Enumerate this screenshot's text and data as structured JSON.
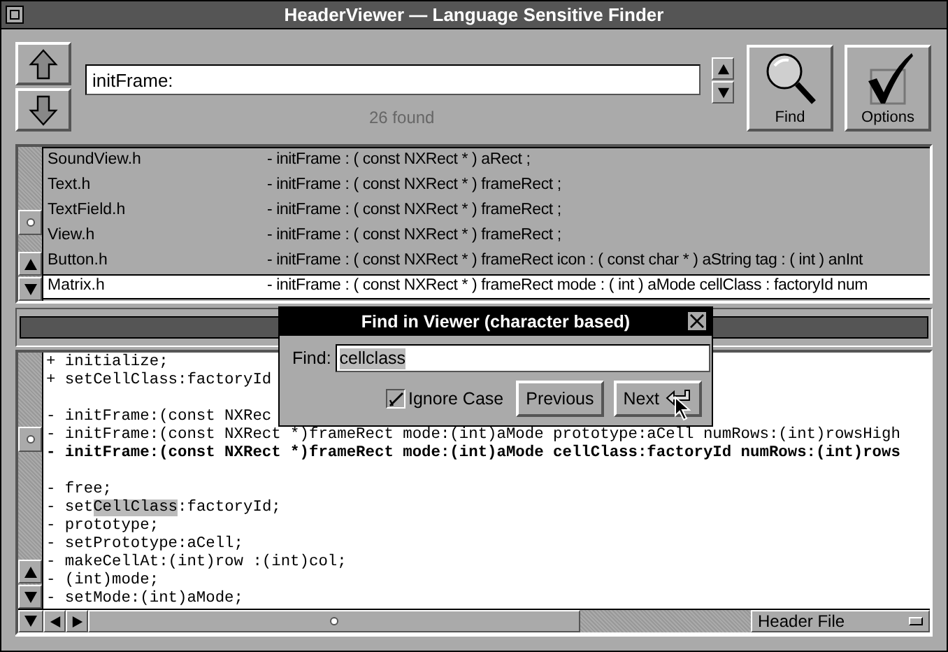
{
  "window": {
    "title": "HeaderViewer — Language Sensitive Finder"
  },
  "search": {
    "value": "initFrame:",
    "status": "26 found"
  },
  "toolbar": [
    {
      "label": "Find",
      "kind": "find"
    },
    {
      "label": "Options",
      "kind": "options"
    }
  ],
  "results": [
    {
      "file": "SoundView.h",
      "signature": "- initFrame : ( const NXRect * ) aRect ;",
      "selected": false
    },
    {
      "file": "Text.h",
      "signature": "- initFrame : ( const NXRect * ) frameRect ;",
      "selected": false
    },
    {
      "file": "TextField.h",
      "signature": "- initFrame : ( const NXRect * ) frameRect ;",
      "selected": false
    },
    {
      "file": "View.h",
      "signature": "- initFrame : ( const NXRect * ) frameRect ;",
      "selected": false
    },
    {
      "file": "Button.h",
      "signature": "- initFrame : ( const NXRect * ) frameRect icon : ( const char * ) aString tag : ( int ) anInt",
      "selected": false
    },
    {
      "file": "Matrix.h",
      "signature": "- initFrame : ( const NXRect * ) frameRect mode : ( int ) aMode cellClass : factoryId num",
      "selected": true
    }
  ],
  "viewer": {
    "lines": [
      {
        "kind": "plain",
        "text": "+ initialize;"
      },
      {
        "kind": "plain",
        "text": "+ setCellClass:factoryId"
      },
      {
        "kind": "blank"
      },
      {
        "kind": "plain",
        "text": "- initFrame:(const NXRec"
      },
      {
        "kind": "plain",
        "text": "- initFrame:(const NXRect *)frameRect mode:(int)aMode prototype:aCell numRows:(int)rowsHigh"
      },
      {
        "kind": "bold",
        "text": "- initFrame:(const NXRect *)frameRect mode:(int)aMode cellClass:factoryId numRows:(int)rows"
      },
      {
        "kind": "blank"
      },
      {
        "kind": "plain",
        "text": "- free;"
      },
      {
        "kind": "match",
        "before": "- set",
        "match": "CellClass",
        "after": ":factoryId;"
      },
      {
        "kind": "plain",
        "text": "- prototype;"
      },
      {
        "kind": "plain",
        "text": "- setPrototype:aCell;"
      },
      {
        "kind": "plain",
        "text": "- makeCellAt:(int)row :(int)col;"
      },
      {
        "kind": "plain",
        "text": "- (int)mode;"
      },
      {
        "kind": "plain",
        "text": "- setMode:(int)aMode;"
      }
    ],
    "popup": "Header File"
  },
  "find_dialog": {
    "title": "Find in Viewer (character based)",
    "label": "Find:",
    "value": "cellclass",
    "ignore_case": {
      "label": "Ignore Case",
      "checked": true
    },
    "buttons": [
      {
        "label": "Previous",
        "kind": "plain"
      },
      {
        "label": "Next",
        "kind": "return"
      }
    ]
  }
}
